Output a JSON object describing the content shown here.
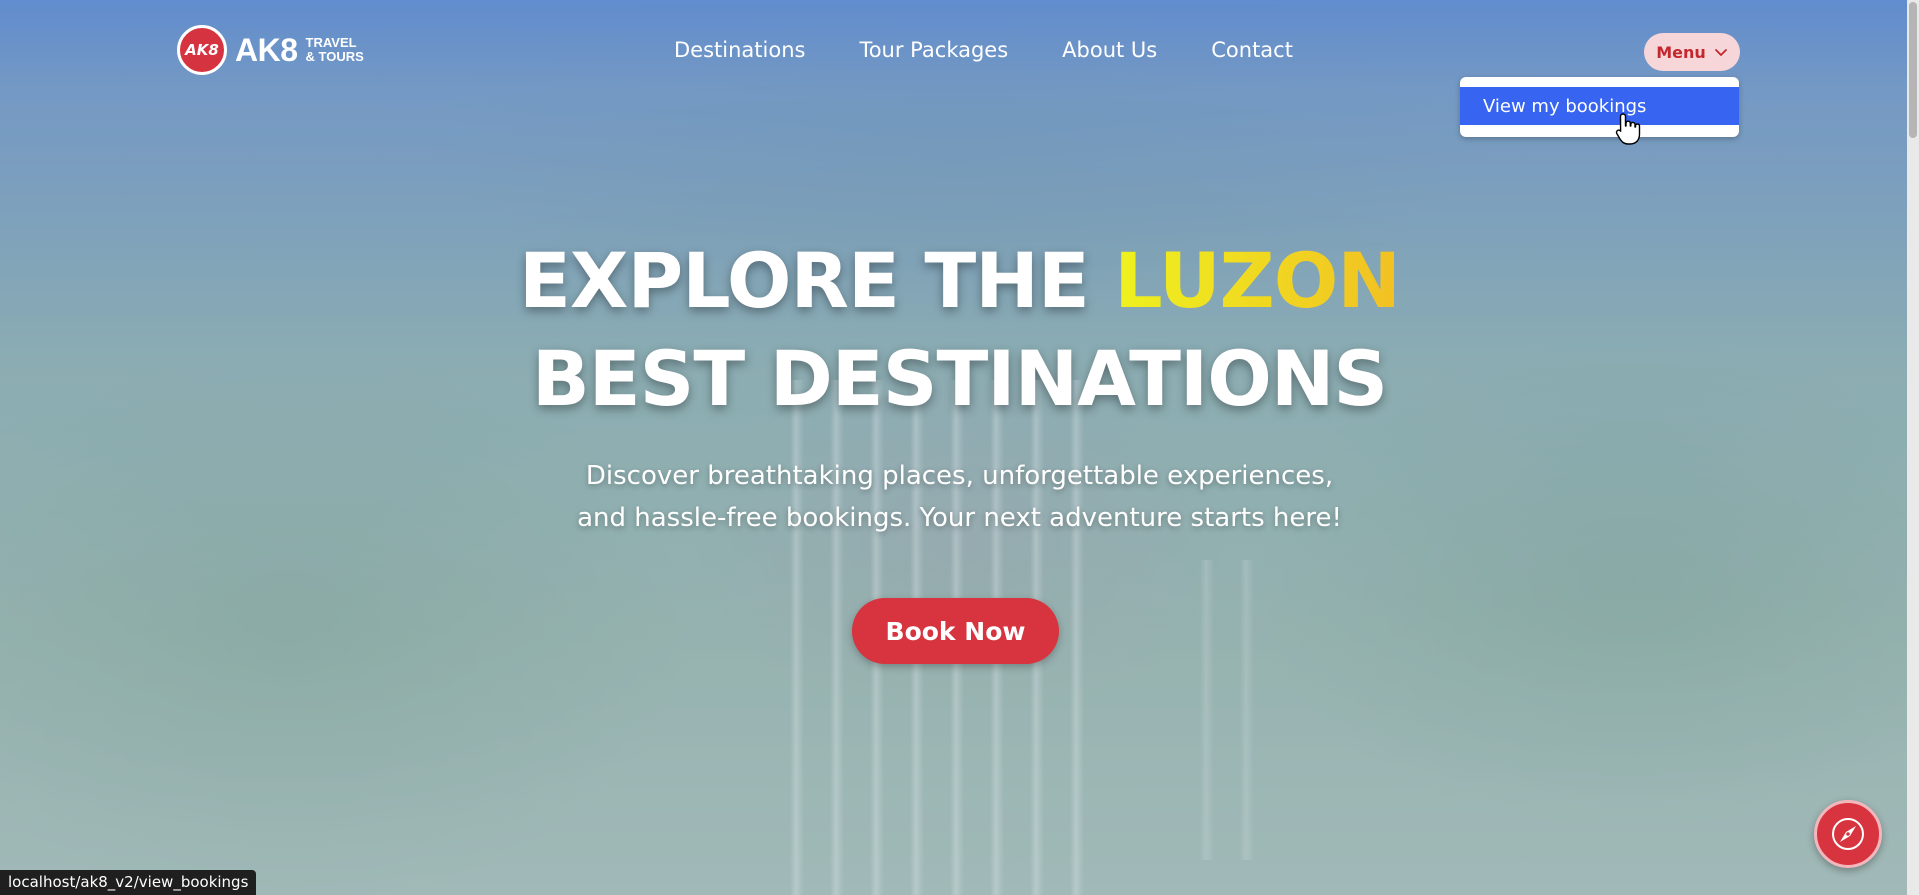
{
  "brand": {
    "badge_text": "AK8",
    "name": "AK8",
    "sub_line1": "TRAVEL",
    "sub_line2": "& TOURS",
    "accent_color": "#d7343f"
  },
  "nav": {
    "items": [
      {
        "label": "Destinations"
      },
      {
        "label": "Tour Packages"
      },
      {
        "label": "About Us"
      },
      {
        "label": "Contact"
      }
    ]
  },
  "menu": {
    "label": "Menu",
    "icon": "chevron-down-icon",
    "dropdown": {
      "items": [
        {
          "label": "View my bookings",
          "highlighted": true
        }
      ],
      "highlight_color": "#3764f0"
    }
  },
  "hero": {
    "title_part1": "EXPLORE THE ",
    "title_accent": "LUZON",
    "title_line2": "BEST DESTINATIONS",
    "subtitle_line1": "Discover breathtaking places, unforgettable experiences,",
    "subtitle_line2": "and hassle-free bookings. Your next adventure starts here!",
    "cta_label": "Book Now",
    "accent_color": "#f3d31f"
  },
  "fab": {
    "icon": "compass-icon"
  },
  "status_bar": {
    "url": "localhost/ak8_v2/view_bookings"
  }
}
